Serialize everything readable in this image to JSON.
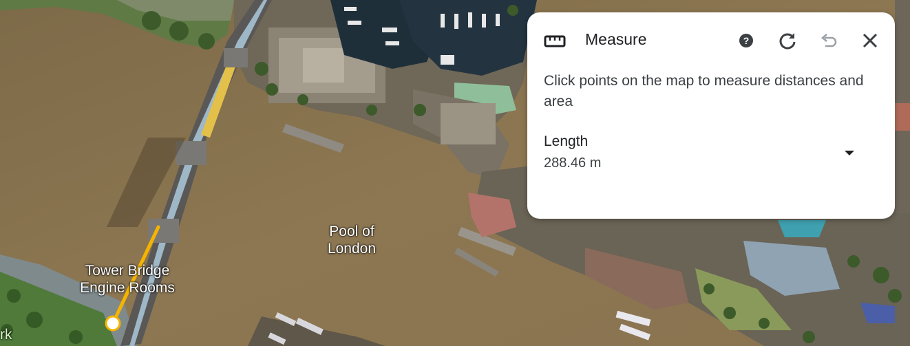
{
  "map": {
    "labels": {
      "pool_line1": "Pool of",
      "pool_line2": "London",
      "bridge_line1": "Tower Bridge",
      "bridge_line2": "Engine Rooms",
      "park_fragment": "rk"
    },
    "colors": {
      "river": "#8a7552",
      "measure_line": "#f5b400",
      "bridge_accent": "#e3c04a"
    }
  },
  "measure_panel": {
    "title": "Measure",
    "icons": {
      "ruler": "ruler-icon",
      "help": "help-icon",
      "reset": "refresh-icon",
      "undo": "undo-icon",
      "close": "close-icon",
      "dropdown": "caret-down-icon"
    },
    "instructions": "Click points on the map to measure distances and area",
    "metric_label": "Length",
    "metric_value": "288.46 m"
  }
}
